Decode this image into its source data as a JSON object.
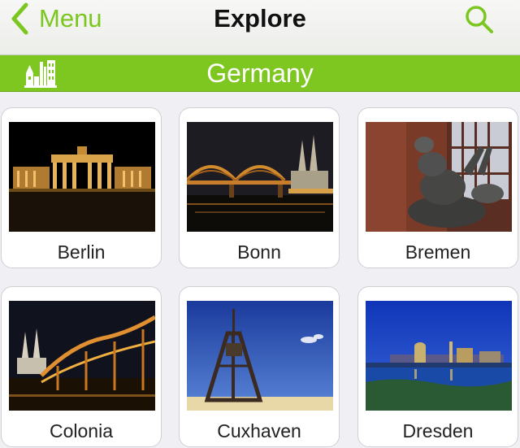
{
  "nav": {
    "back_label": "Menu",
    "title": "Explore"
  },
  "section": {
    "title": "Germany"
  },
  "cities": [
    {
      "name": "Berlin"
    },
    {
      "name": "Bonn"
    },
    {
      "name": "Bremen"
    },
    {
      "name": "Colonia"
    },
    {
      "name": "Cuxhaven"
    },
    {
      "name": "Dresden"
    }
  ],
  "colors": {
    "accent": "#7cc620",
    "section_bar": "#7ec620",
    "background": "#efeff4"
  },
  "icons": {
    "back": "chevron-left-icon",
    "search": "search-icon",
    "section": "city-skyline-icon"
  }
}
